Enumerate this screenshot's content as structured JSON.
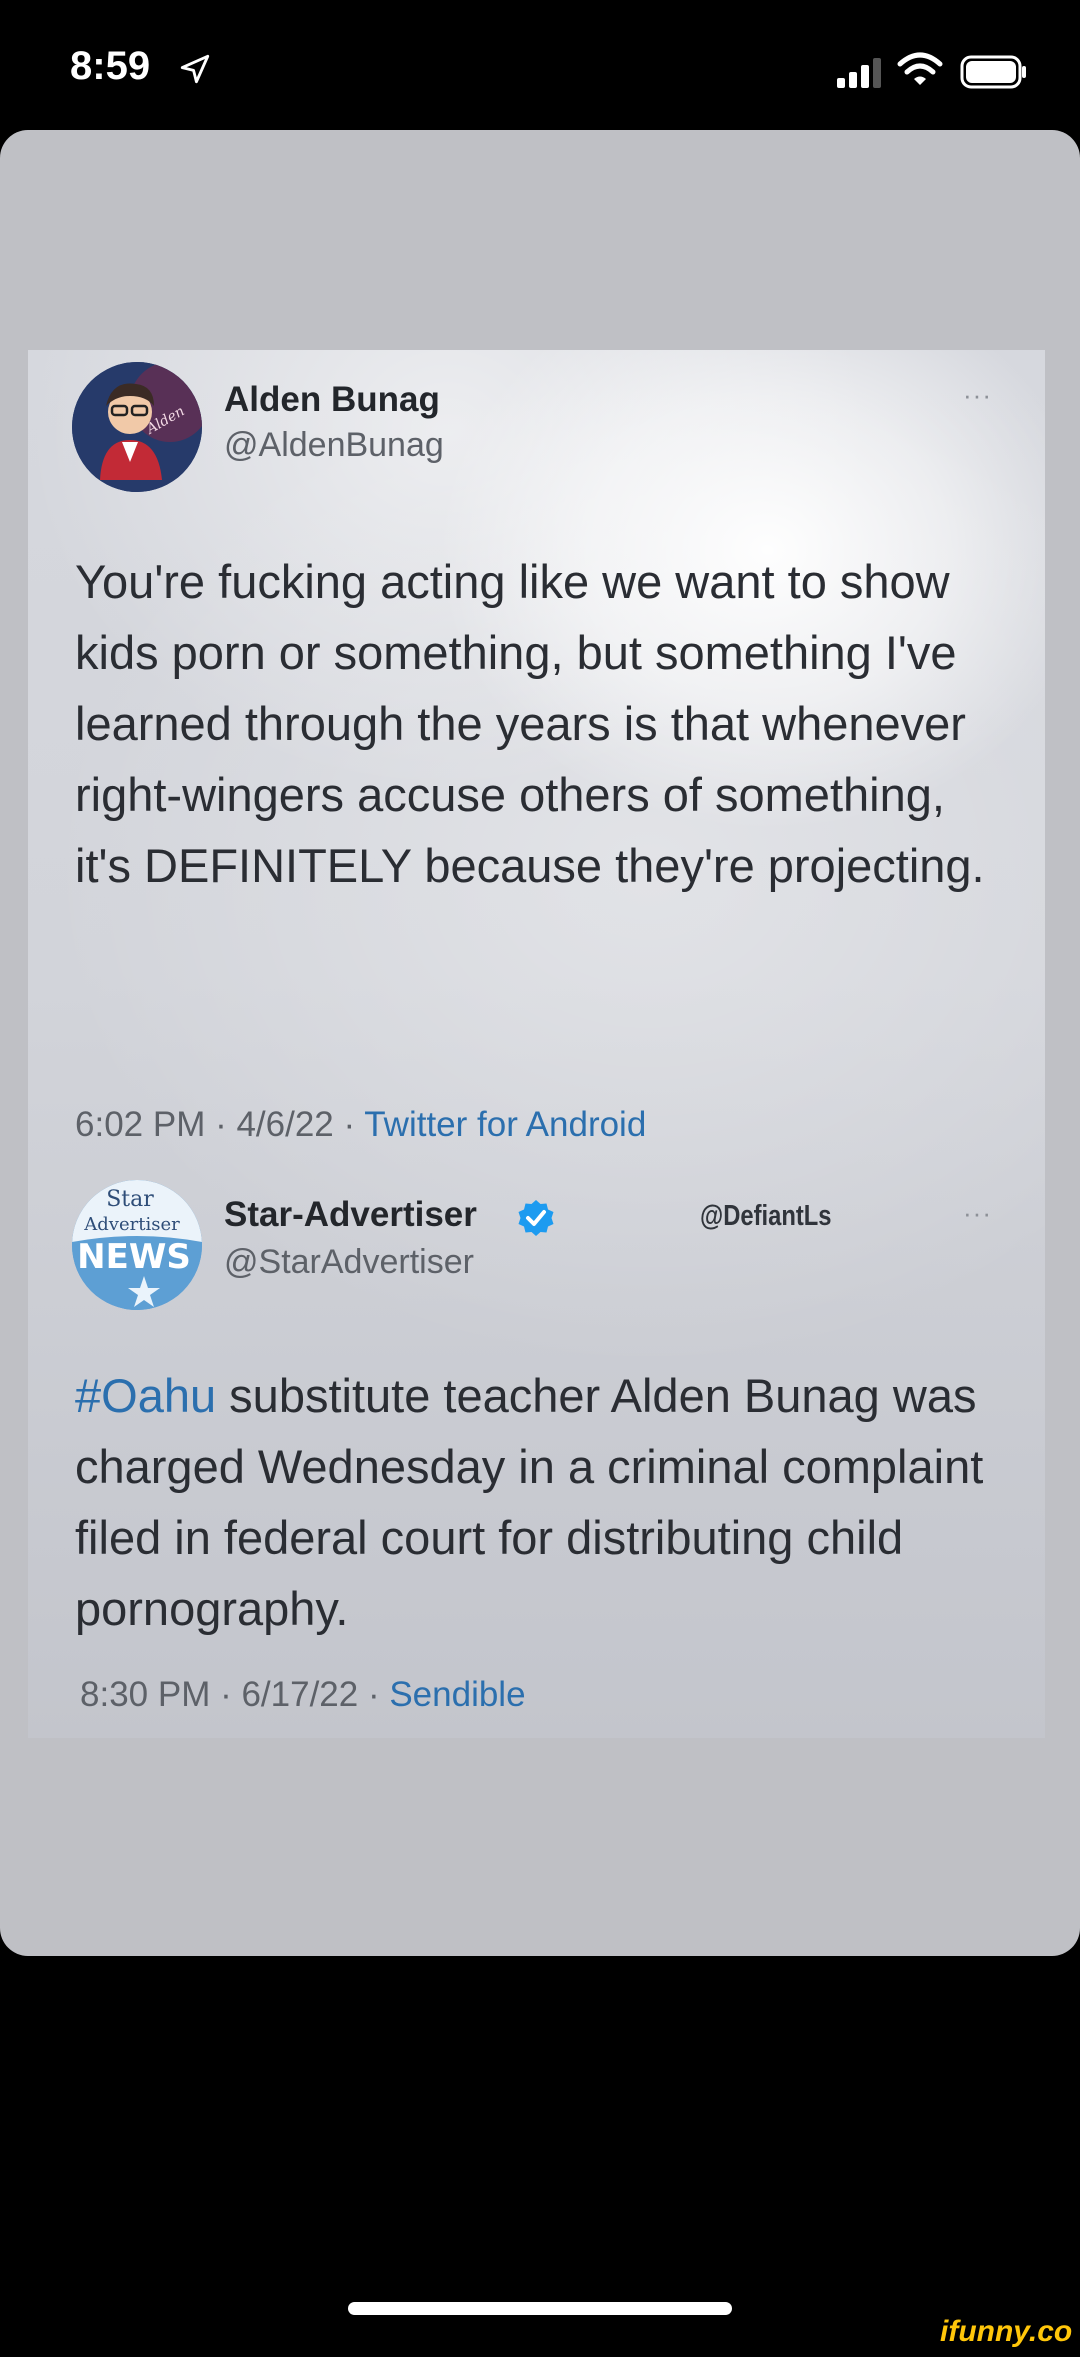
{
  "status_bar": {
    "time": "8:59"
  },
  "tweet1": {
    "name": "Alden Bunag",
    "handle": "@AldenBunag",
    "more": "···",
    "body": "You're fucking acting like we want to show kids porn or something, but something I've learned through the years is that whenever right-wingers accuse others of something, it's DEFINITELY because they're projecting.",
    "time": "6:02 PM · 4/6/22 · ",
    "source": "Twitter for Android"
  },
  "tweet2": {
    "name": "Star-Advertiser",
    "handle": "@StarAdvertiser",
    "overlay_handle": "@DefiantLs",
    "more": "···",
    "hashtag": "#Oahu",
    "body": " substitute teacher Alden Bunag was charged Wednesday in a criminal complaint filed in federal court for distributing child pornography.",
    "time": "8:30 PM · 6/17/22 · ",
    "source": "Sendible",
    "avatar_text": {
      "line1": "Star",
      "line2": "Advertiser",
      "line3": "NEWS"
    }
  },
  "avatar1_text": "Alden",
  "watermark": "ifunny.co",
  "colors": {
    "link": "#2b6fae",
    "verified": "#1d9bf0",
    "ifunny": "#ffc60a"
  }
}
